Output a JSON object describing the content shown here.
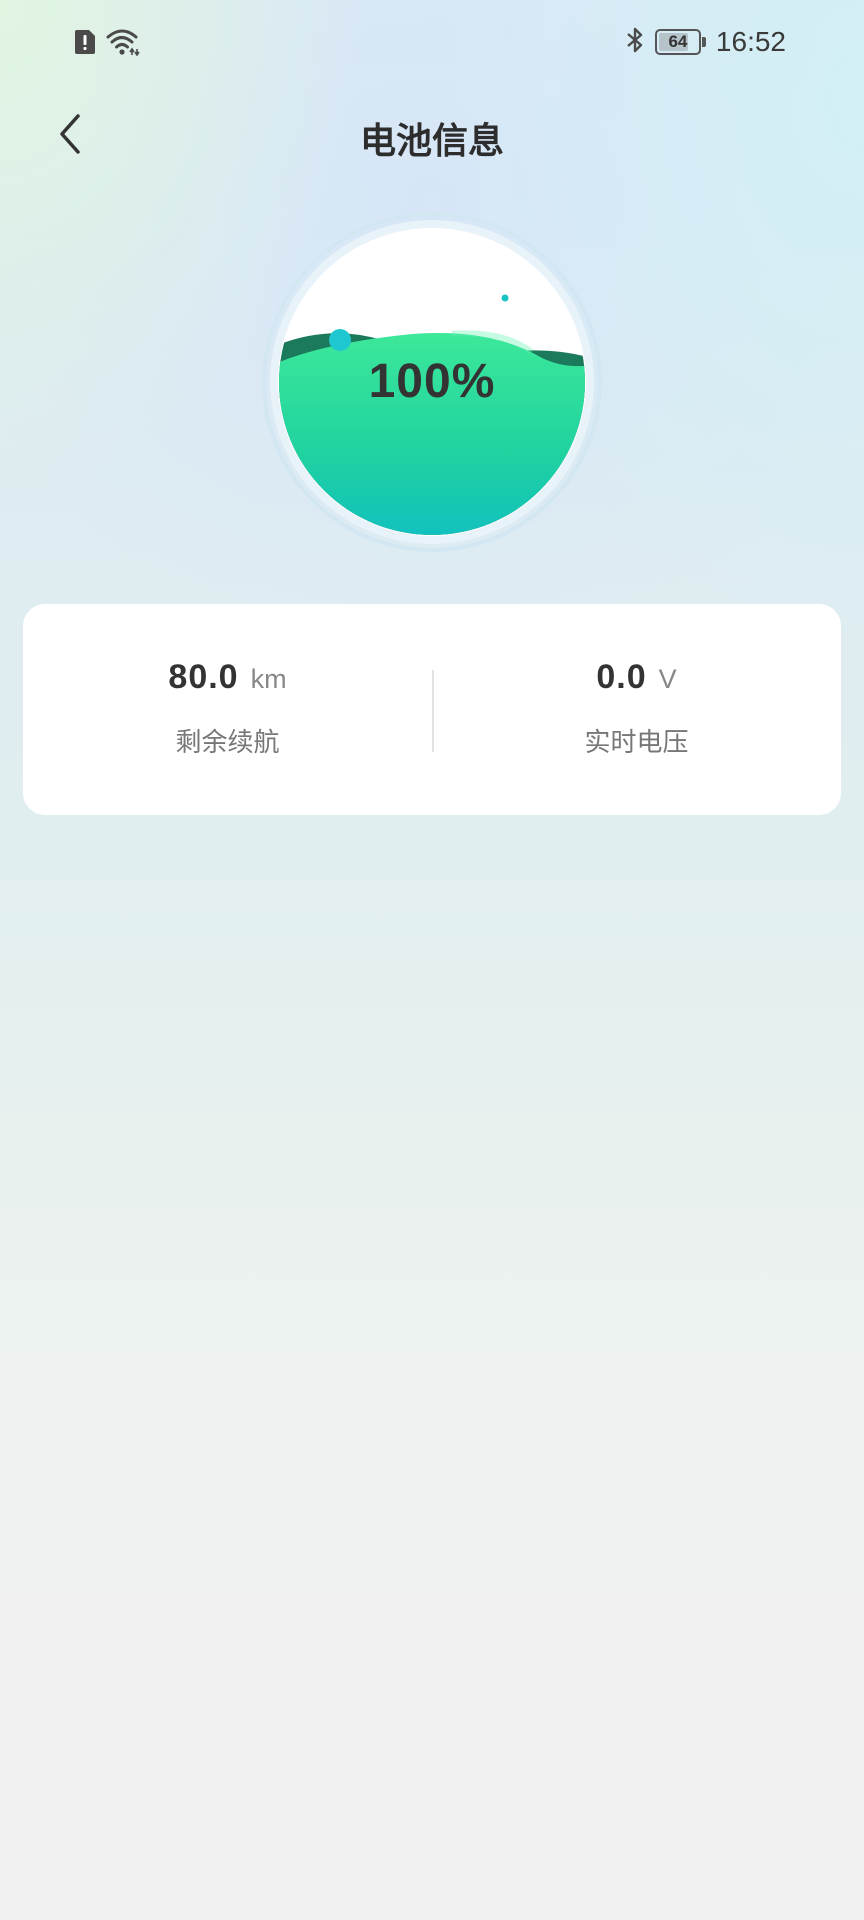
{
  "status_bar": {
    "time": "16:52",
    "battery_level": "64",
    "icons": [
      "sim-alert-icon",
      "wifi-icon",
      "bluetooth-icon",
      "battery-icon"
    ]
  },
  "nav": {
    "title": "电池信息",
    "back_icon": "chevron-left-icon"
  },
  "battery_gauge": {
    "percent_text": "100%",
    "level": 1.0,
    "colors": {
      "wave_top": "#3de89a",
      "wave_bottom": "#0fbdc4",
      "back_wave": "#1c7a5c",
      "ring": "#cfe6f2"
    }
  },
  "stats": {
    "range": {
      "value": "80.0",
      "unit": "km",
      "label": "剩余续航"
    },
    "voltage": {
      "value": "0.0",
      "unit": "V",
      "label": "实时电压"
    }
  }
}
